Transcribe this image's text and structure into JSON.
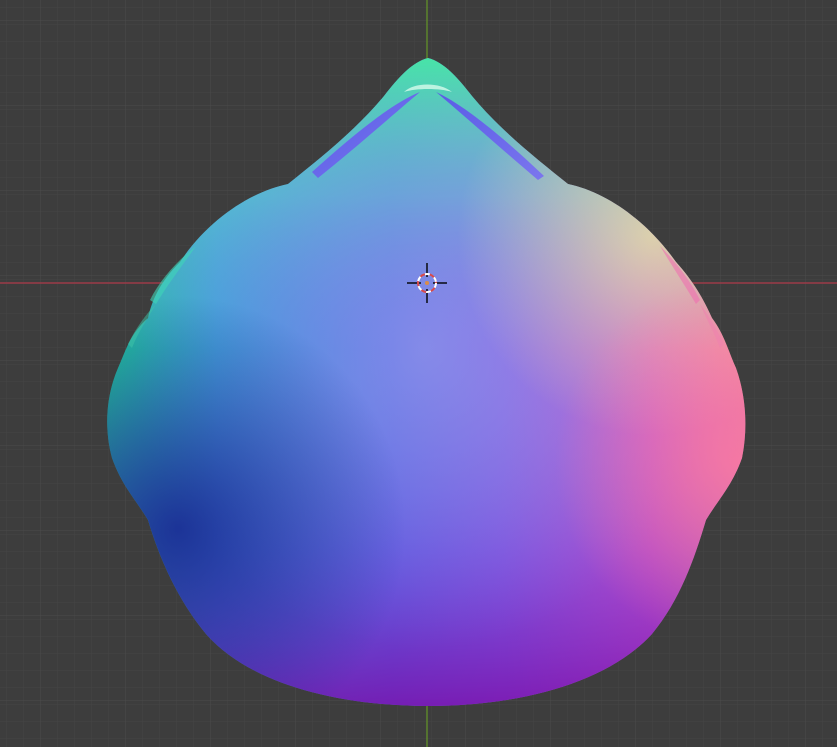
{
  "viewport": {
    "view": "3d-viewport",
    "shading": "normal-map",
    "grid": true,
    "colors": {
      "background": "#3d3d3d",
      "grid_minor": "#454545",
      "grid_major": "#4f4f4f",
      "x_axis": "#9b3b48",
      "y_axis": "#5f8a2a",
      "cursor_ring_a": "#d94a4a",
      "cursor_ring_b": "#ffffff"
    }
  },
  "object": {
    "name_visible": false,
    "shading_colors": {
      "top_highlight": "#3ee8a6",
      "upper_left": "#25d59a",
      "center": "#6a85e0",
      "right": "#e45fb8",
      "lower": "#7b2bd9",
      "bottom_left": "#1a2ea0",
      "bottom": "#8a10b0"
    }
  },
  "cursor": {
    "icon": "3d-cursor-icon"
  }
}
